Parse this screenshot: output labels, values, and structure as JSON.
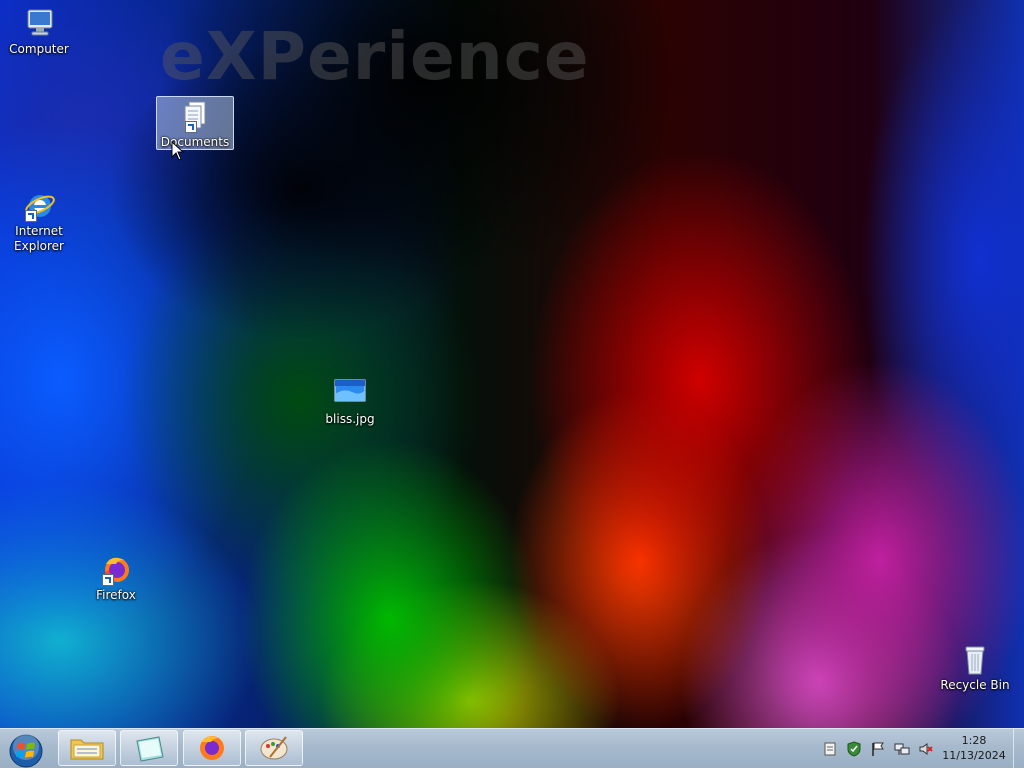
{
  "desktop": {
    "watermark": "eXPerience",
    "icons": [
      {
        "label": "Computer",
        "icon": "computer-icon"
      },
      {
        "label": "Documents",
        "icon": "documents-icon"
      },
      {
        "label": "Internet Explorer",
        "icon": "internet-explorer-icon"
      },
      {
        "label": "bliss.jpg",
        "icon": "image-file-icon"
      },
      {
        "label": "Firefox",
        "icon": "firefox-icon"
      },
      {
        "label": "Recycle Bin",
        "icon": "recycle-bin-icon"
      }
    ],
    "selected_icon": "Documents"
  },
  "taskbar": {
    "start_icon": "windows-start-orb-icon",
    "pinned": [
      {
        "name": "Windows Explorer",
        "icon": "folder-icon"
      },
      {
        "name": "Notepad",
        "icon": "notepad-icon"
      },
      {
        "name": "Firefox",
        "icon": "firefox-icon"
      },
      {
        "name": "Paint",
        "icon": "paint-icon"
      }
    ],
    "tray_icons": [
      "notes-icon",
      "security-shield-icon",
      "action-center-flag-icon",
      "network-icon",
      "volume-muted-icon"
    ],
    "clock": {
      "time": "1:28",
      "date": "11/13/2024"
    }
  },
  "colors": {
    "taskbar": "#a7bacd",
    "selection": "#b4c8e6"
  }
}
